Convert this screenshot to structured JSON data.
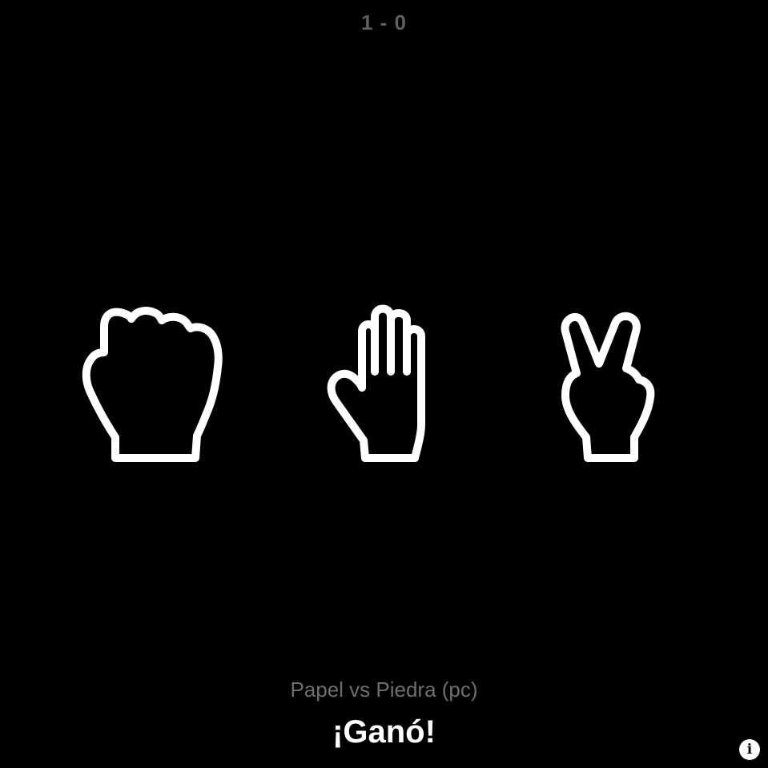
{
  "score": "1 - 0",
  "hands": [
    {
      "id": "rock",
      "icon": "rock-fist-icon"
    },
    {
      "id": "paper",
      "icon": "paper-open-hand-icon"
    },
    {
      "id": "scissors",
      "icon": "scissors-victory-hand-icon"
    }
  ],
  "matchup": "Papel vs Piedra (pc)",
  "result": "¡Ganó!",
  "info_button": {
    "label": "i",
    "icon": "info-icon"
  },
  "colors": {
    "background": "#000000",
    "icon_stroke": "#ffffff",
    "score_text": "#5f5f5f",
    "matchup_text": "#6e6e6e",
    "result_text": "#ffffff"
  }
}
